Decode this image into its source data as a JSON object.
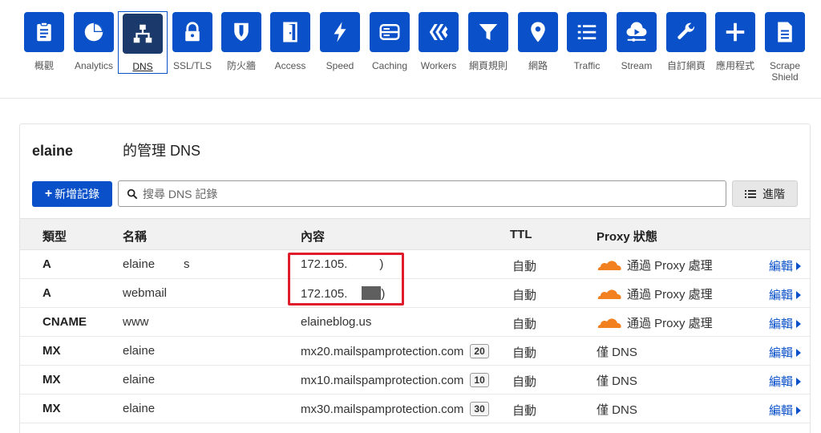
{
  "nav": [
    {
      "label": "概觀",
      "icon": "clipboard-icon"
    },
    {
      "label": "Analytics",
      "icon": "pie-chart-icon"
    },
    {
      "label": "DNS",
      "icon": "network-icon",
      "active": true
    },
    {
      "label": "SSL/TLS",
      "icon": "lock-icon"
    },
    {
      "label": "防火牆",
      "icon": "shield-icon"
    },
    {
      "label": "Access",
      "icon": "door-icon"
    },
    {
      "label": "Speed",
      "icon": "lightning-icon"
    },
    {
      "label": "Caching",
      "icon": "server-icon"
    },
    {
      "label": "Workers",
      "icon": "workers-icon"
    },
    {
      "label": "網頁規則",
      "icon": "filter-icon"
    },
    {
      "label": "網路",
      "icon": "location-pin-icon"
    },
    {
      "label": "Traffic",
      "icon": "list-icon"
    },
    {
      "label": "Stream",
      "icon": "cloud-stream-icon"
    },
    {
      "label": "自訂網頁",
      "icon": "wrench-icon"
    },
    {
      "label": "應用程式",
      "icon": "plus-icon"
    },
    {
      "label": "Scrape Shield",
      "icon": "document-icon"
    }
  ],
  "panel": {
    "title_domain": "elaine",
    "title_suffix": "的管理 DNS",
    "add_button": "新增記錄",
    "search_placeholder": "搜尋 DNS 記錄",
    "advanced_button": "進階"
  },
  "table": {
    "headers": {
      "type": "類型",
      "name": "名稱",
      "content": "內容",
      "ttl": "TTL",
      "proxy": "Proxy 狀態"
    },
    "rows": [
      {
        "type": "A",
        "name": "elaine",
        "name_tail": "s",
        "content": "172.105.",
        "content_tail": ")",
        "ttl": "自動",
        "proxy": "通過 Proxy 處理",
        "proxied": true,
        "edit": "編輯"
      },
      {
        "type": "A",
        "name": "webmail",
        "content": "172.105.",
        "content_tail": ")",
        "ttl": "自動",
        "proxy": "通過 Proxy 處理",
        "proxied": true,
        "edit": "編輯",
        "gray_mask": true
      },
      {
        "type": "CNAME",
        "name": "www",
        "content": "elaineblog.us",
        "ttl": "自動",
        "proxy": "通過 Proxy 處理",
        "proxied": true,
        "edit": "編輯"
      },
      {
        "type": "MX",
        "name": "elaine",
        "content": "mx20.mailspamprotection.com",
        "priority": "20",
        "ttl": "自動",
        "proxy": "僅 DNS",
        "proxied": false,
        "edit": "編輯"
      },
      {
        "type": "MX",
        "name": "elaine",
        "content": "mx10.mailspamprotection.com",
        "priority": "10",
        "ttl": "自動",
        "proxy": "僅 DNS",
        "proxied": false,
        "edit": "編輯"
      },
      {
        "type": "MX",
        "name": "elaine",
        "content": "mx30.mailspamprotection.com",
        "priority": "30",
        "ttl": "自動",
        "proxy": "僅 DNS",
        "proxied": false,
        "edit": "編輯"
      }
    ]
  },
  "colors": {
    "accent": "#0a51c9",
    "cloud": "#f38020",
    "highlight": "#e01b2b"
  }
}
